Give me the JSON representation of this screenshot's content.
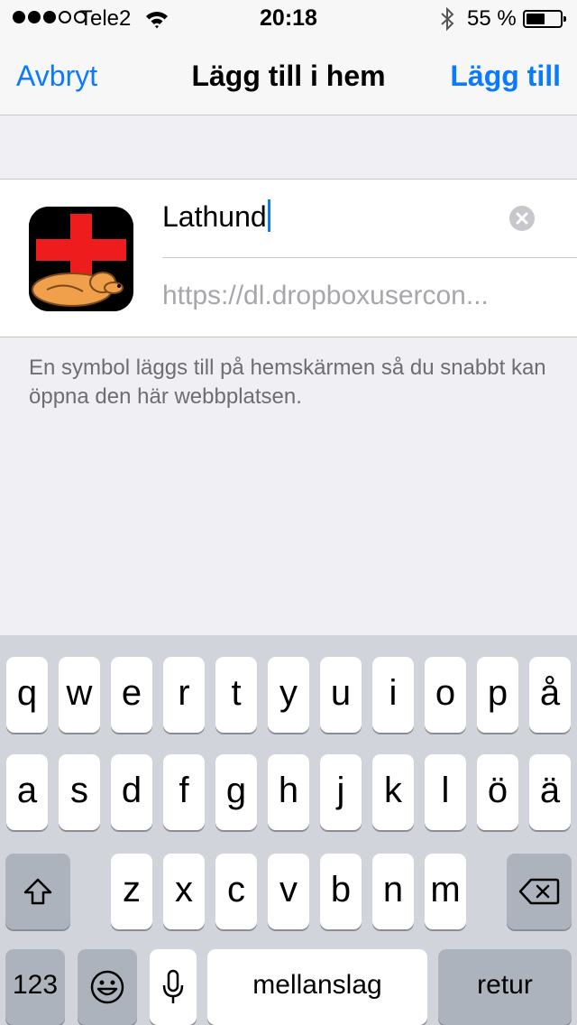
{
  "status_bar": {
    "carrier": "Tele2",
    "time": "20:18",
    "battery_percent": "55 %",
    "battery_level": 0.55,
    "signal_bars_filled": 3,
    "signal_bars_total": 5
  },
  "nav": {
    "cancel_label": "Avbryt",
    "title": "Lägg till i hem",
    "add_label": "Lägg till"
  },
  "form": {
    "name_value": "Lathund",
    "url_value": "https://dl.dropboxusercon..."
  },
  "hint_text": "En symbol läggs till på hemskärmen så du snabbt kan öppna den här webbplatsen.",
  "keyboard": {
    "row1": [
      "q",
      "w",
      "e",
      "r",
      "t",
      "y",
      "u",
      "i",
      "o",
      "p",
      "å"
    ],
    "row2": [
      "a",
      "s",
      "d",
      "f",
      "g",
      "h",
      "j",
      "k",
      "l",
      "ö",
      "ä"
    ],
    "row3": [
      "z",
      "x",
      "c",
      "v",
      "b",
      "n",
      "m"
    ],
    "numbers_label": "123",
    "space_label": "mellanslag",
    "return_label": "retur"
  },
  "colors": {
    "accent": "#0a7aff",
    "background": "#efeff4",
    "keyboard_bg": "#d1d5db"
  },
  "icons": [
    "wifi-icon",
    "bluetooth-icon",
    "battery-icon",
    "clear-text-icon",
    "shift-icon",
    "backspace-icon",
    "emoji-icon",
    "microphone-icon"
  ]
}
